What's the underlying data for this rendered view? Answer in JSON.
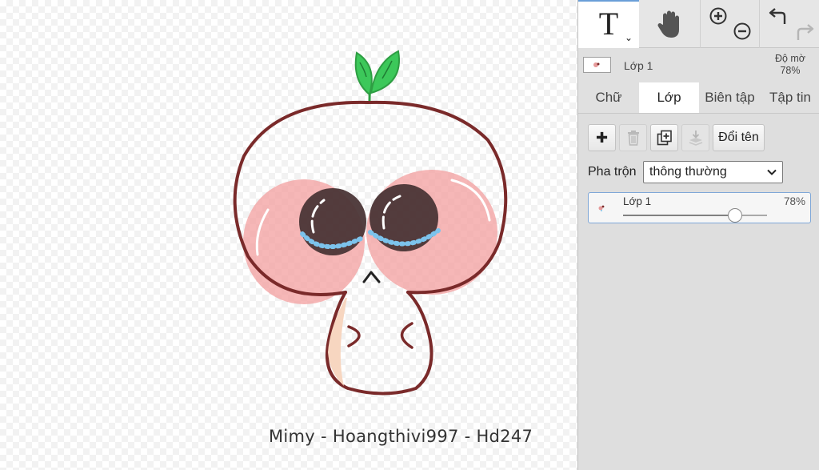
{
  "canvas": {
    "signature": "Mimy - Hoangthivi997 - Hd247"
  },
  "toolbar": {
    "text_tool_glyph": "T",
    "text_tool_caret": "⌄",
    "hand_tool_icon": "hand-icon",
    "zoom_in_icon": "zoom-in-icon",
    "zoom_out_icon": "zoom-out-icon",
    "undo_icon": "undo-icon",
    "redo_icon": "redo-icon"
  },
  "layer_info": {
    "name": "Lớp 1",
    "opacity_label": "Độ mờ",
    "opacity_value": "78%"
  },
  "tabs": [
    {
      "label": "Chữ",
      "active": false
    },
    {
      "label": "Lớp",
      "active": true
    },
    {
      "label": "Biên tập",
      "active": false
    },
    {
      "label": "Tập tin",
      "active": false
    }
  ],
  "layers_tab": {
    "add_glyph": "✚",
    "rename_label": "Đổi tên",
    "blend_label": "Pha trộn",
    "blend_value": "thông thường",
    "layers": [
      {
        "name": "Lớp 1",
        "opacity_text": "78%",
        "opacity": 0.78
      }
    ]
  },
  "colors": {
    "accent": "#7ea7d8",
    "outline": "#7a2a2a",
    "blush": "#f4a3a3",
    "eyes": "#4a3536",
    "tears": "#7cc3ec",
    "leaf": "#3cc85a"
  }
}
